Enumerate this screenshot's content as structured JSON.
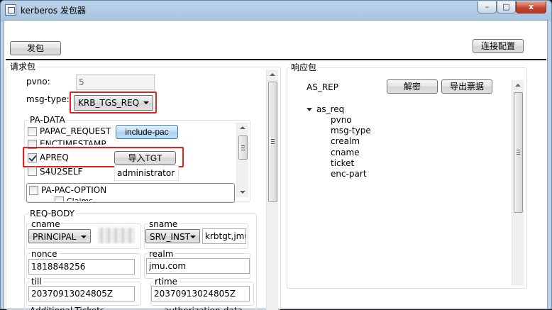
{
  "window": {
    "title": "kerberos 发包器",
    "minimize": "–",
    "maximize": "□",
    "close": "x"
  },
  "toolbar": {
    "send_label": "发包",
    "connect_config_label": "连接配置"
  },
  "request": {
    "group_label": "请求包",
    "pvno_label": "pvno:",
    "pvno_value": "5",
    "msg_type_label": "msg-type:",
    "msg_type_value": "KRB_TGS_REQ",
    "pa_data": {
      "group_label": "PA-DATA",
      "items": [
        {
          "label": "PAPAC_REQUEST",
          "checked": false
        },
        {
          "label": "ENCTIMESTAMP",
          "checked": false
        },
        {
          "label": "APREQ",
          "checked": true
        },
        {
          "label": "S4U2SELF",
          "checked": false
        }
      ],
      "include_pac_label": "include-pac",
      "import_tgt_label": "导入TGT",
      "user_value": "administrator",
      "pa_pac_option_label": "PA-PAC-OPTION",
      "pa_pac_sub_label": "Claims"
    },
    "req_body": {
      "group_label": "REQ-BODY",
      "cname_label": "cname",
      "cname_type": "PRINCIPAL",
      "sname_label": "sname",
      "sname_type": "SRV_INST",
      "sname_value": "krbtgt,jmu",
      "nonce_label": "nonce",
      "nonce_value": "1818848256",
      "realm_label": "realm",
      "realm_value": "jmu.com",
      "till_label": "till",
      "till_value": "20370913024805Z",
      "rtime_label": "rtime",
      "rtime_value": "20370913024805Z",
      "additional_tickets_label": "Additional-Tickets",
      "authorization_data_label": "authorization-data"
    }
  },
  "response": {
    "group_label": "响应包",
    "type_label": "AS_REP",
    "decrypt_label": "解密",
    "export_ticket_label": "导出票据",
    "tree": {
      "root": "as_req",
      "children": [
        "pvno",
        "msg-type",
        "crealm",
        "cname",
        "ticket",
        "enc-part"
      ]
    }
  }
}
